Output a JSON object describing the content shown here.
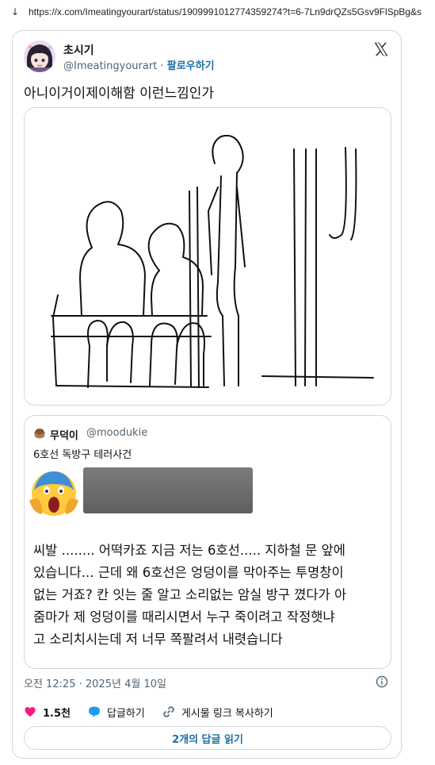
{
  "browser": {
    "url": "https://x.com/Imeatingyourart/status/1909991012774359274?t=6-7Ln9drQZs5Gsv9FlSpBg&s",
    "download_icon": "down-arrow-icon"
  },
  "tweet": {
    "author_name": "초시기",
    "author_handle": "@Imeatingyourart",
    "separator": "·",
    "follow_label": "팔로우하기",
    "text": "아니이거이제이해함 이런느낌인가",
    "timestamp": "오전 12:25 · 2025년 4월 10일",
    "likes_count": "1.5천",
    "reply_label": "답글하기",
    "copy_link_label": "게시물 링크 복사하기",
    "read_replies_label": "2개의 답글 읽기"
  },
  "quote": {
    "author_name": "무덕이",
    "author_handle": "@moodukie",
    "text": "6호선 독방구 테러사건",
    "body_lines": [
      "씨발 ........ 어떡카죠 지금 저는 6호선..... 지하철 문 앞에",
      "있습니다... 근데 왜 6호선은 엉덩이를 막아주는 투명창이",
      "없는 거죠? 칸 잇는 줄 알고 소리없는 암실 방구 꼈다가 아",
      "줌마가 제 엉덩이를 때리시면서 누구 죽이려고 작정햇냐",
      "고 소리치시는데 저 너무 쪽팔려서 내렷습니다"
    ]
  },
  "colors": {
    "link": "#1d6fa5",
    "border": "#cfd9de",
    "secondary_text": "#536471",
    "like_heart": "#f91880",
    "reply_bubble": "#1d9bf0"
  }
}
